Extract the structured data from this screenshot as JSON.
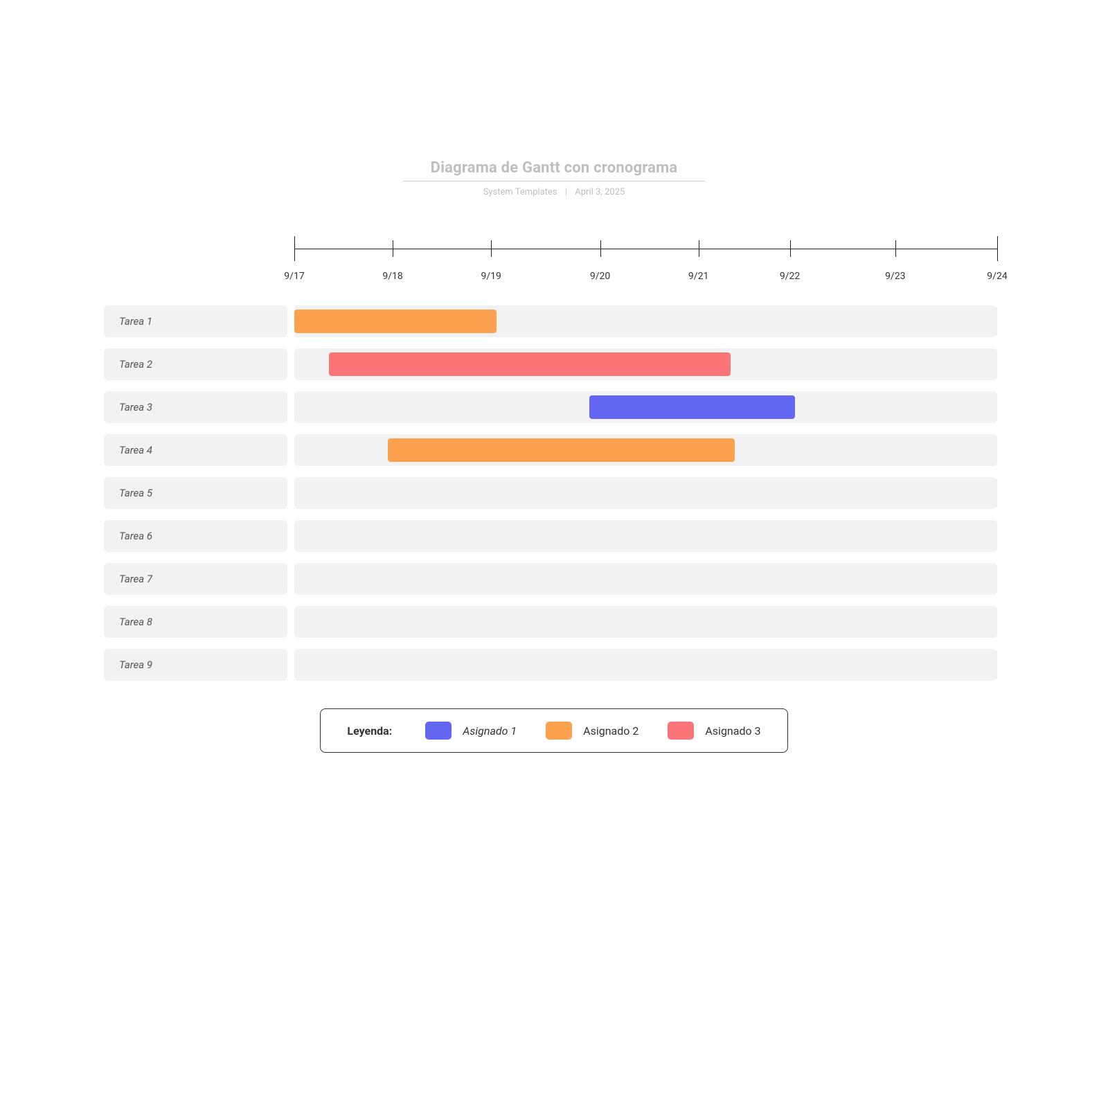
{
  "header": {
    "title": "Diagrama de Gantt con cronograma",
    "author": "System Templates",
    "date": "April 3, 2025"
  },
  "legend": {
    "title": "Leyenda:",
    "items": [
      {
        "label": "Asignado 1",
        "color": "#6366f1",
        "italic": true
      },
      {
        "label": "Asignado 2",
        "color": "#fca14e",
        "italic": false
      },
      {
        "label": "Asignado 3",
        "color": "#fb7477",
        "italic": false
      }
    ]
  },
  "chart_data": {
    "type": "bar",
    "title": "Diagrama de Gantt con cronograma",
    "xlabel": "",
    "ylabel": "",
    "x_range": [
      17,
      24
    ],
    "categories": [
      "9/17",
      "9/18",
      "9/19",
      "9/20",
      "9/21",
      "9/22",
      "9/23",
      "9/24"
    ],
    "tasks": [
      {
        "name": "Tarea 1",
        "start": 17.0,
        "end": 19.05,
        "assignee": "Asignado 2",
        "color": "#fca14e"
      },
      {
        "name": "Tarea 2",
        "start": 17.35,
        "end": 21.35,
        "assignee": "Asignado 3",
        "color": "#fb7477"
      },
      {
        "name": "Tarea 3",
        "start": 19.9,
        "end": 22.05,
        "assignee": "Asignado 1",
        "color": "#6366f1"
      },
      {
        "name": "Tarea 4",
        "start": 17.95,
        "end": 21.4,
        "assignee": "Asignado 2",
        "color": "#fca14e"
      },
      {
        "name": "Tarea 5"
      },
      {
        "name": "Tarea 6"
      },
      {
        "name": "Tarea 7"
      },
      {
        "name": "Tarea 8"
      },
      {
        "name": "Tarea 9"
      }
    ]
  }
}
